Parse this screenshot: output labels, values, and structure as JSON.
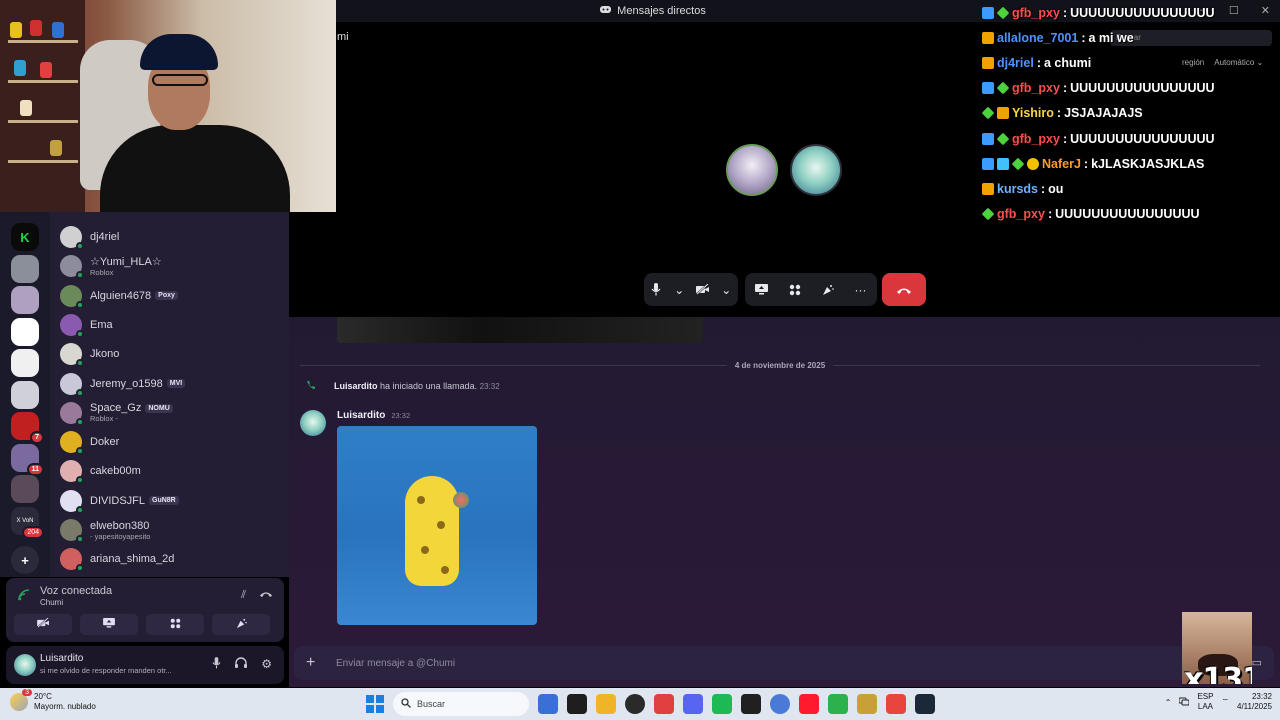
{
  "window": {
    "title": "Mensajes directos",
    "controls": [
      "—",
      "☐",
      "✕"
    ]
  },
  "call": {
    "caption": "mi",
    "search_placeholder": "Buscar",
    "region_label": "región",
    "region_value": "Automático ⌄"
  },
  "twitch_chat": [
    {
      "user": "gfb_pxy",
      "color": "#ff4d4d",
      "badges": [
        "b-prime",
        "b-gem"
      ],
      "message": "UUUUUUUUUUUUUUUU"
    },
    {
      "user": "allalone_7001",
      "color": "#4f93ff",
      "badges": [
        "b-sub"
      ],
      "message": "a mi we"
    },
    {
      "user": "dj4riel",
      "color": "#4f93ff",
      "badges": [
        "b-sub"
      ],
      "message": "a chumi"
    },
    {
      "user": "gfb_pxy",
      "color": "#ff4d4d",
      "badges": [
        "b-prime",
        "b-gem"
      ],
      "message": "UUUUUUUUUUUUUUUU"
    },
    {
      "user": "Yishiro",
      "color": "#ffd24a",
      "badges": [
        "b-gem",
        "b-sub"
      ],
      "message": "JSJAJAJAJS"
    },
    {
      "user": "gfb_pxy",
      "color": "#ff4d4d",
      "badges": [
        "b-prime",
        "b-gem"
      ],
      "message": "UUUUUUUUUUUUUUUU"
    },
    {
      "user": "NaferJ",
      "color": "#ff9a2e",
      "badges": [
        "b-prime",
        "b-blue",
        "b-gem",
        "b-coin"
      ],
      "message": "kJLASKJASJKLAS"
    },
    {
      "user": "kursds",
      "color": "#6fb2ff",
      "badges": [
        "b-sub"
      ],
      "message": "ou"
    },
    {
      "user": "gfb_pxy",
      "color": "#ff4d4d",
      "badges": [
        "b-gem"
      ],
      "message": "UUUUUUUUUUUUUUUU"
    }
  ],
  "members": [
    {
      "name": "dj4riel",
      "sub": "",
      "tag": "",
      "color": "#d0d0d0"
    },
    {
      "name": "☆Yumi_HLA☆",
      "sub": "Roblox",
      "tag": "",
      "color": "#8c8c9c"
    },
    {
      "name": "Alguien4678",
      "sub": "",
      "tag": "Poxy",
      "color": "#6a8a5a"
    },
    {
      "name": "Ema",
      "sub": "",
      "tag": "",
      "color": "#8a5ab0"
    },
    {
      "name": "Jkono",
      "sub": "",
      "tag": "",
      "color": "#d8d8d0"
    },
    {
      "name": "Jeremy_o1598",
      "sub": "",
      "tag": "MVI",
      "color": "#c8c8d8"
    },
    {
      "name": "Space_Gz",
      "sub": "Roblox -",
      "tag": "NOMU",
      "color": "#9a7a9a"
    },
    {
      "name": "Doker",
      "sub": "",
      "tag": "",
      "color": "#e0b020"
    },
    {
      "name": "cakeb00m",
      "sub": "",
      "tag": "",
      "color": "#e0b0b0"
    },
    {
      "name": "DIVIDSJFL",
      "sub": "",
      "tag": "GuN8R",
      "color": "#e0e0f0"
    },
    {
      "name": "elwebon380",
      "sub": "- yapesitoyapesito",
      "tag": "",
      "color": "#7a7a6a"
    },
    {
      "name": "ariana_shima_2d",
      "sub": "",
      "tag": "",
      "color": "#d06060"
    }
  ],
  "servers": [
    {
      "label": "K",
      "color": "#0a0a0a",
      "badge": ""
    },
    {
      "label": "",
      "color": "#8a8f9a",
      "badge": ""
    },
    {
      "label": "",
      "color": "#b0a0c0",
      "badge": ""
    },
    {
      "label": "",
      "color": "#ffffff",
      "badge": ""
    },
    {
      "label": "",
      "color": "#f0f0f0",
      "badge": ""
    },
    {
      "label": "",
      "color": "#d0d0d8",
      "badge": ""
    },
    {
      "label": "",
      "color": "#c02020",
      "badge": "7"
    },
    {
      "label": "",
      "color": "#7a6aa0",
      "badge": "11"
    },
    {
      "label": "",
      "color": "#5a4a5a",
      "badge": ""
    },
    {
      "label": "X VoN",
      "color": "#2a2a3a",
      "badge": "204"
    }
  ],
  "voice": {
    "title": "Voz conectada",
    "channel": "Chumi"
  },
  "user": {
    "name": "Luisardito",
    "status": "si me olvido de responder manden otr..."
  },
  "chat": {
    "date_divider": "4 de noviembre de 2025",
    "call_author": "Luisardito",
    "call_text": "ha iniciado una llamada.",
    "call_time": "23:32",
    "msg_author": "Luisardito",
    "msg_time": "23:32",
    "composer_placeholder": "Enviar mensaje a @Chumi"
  },
  "reaction_overlay": {
    "label": "x131"
  },
  "taskbar": {
    "weather_temp": "20°C",
    "weather_desc": "Mayorm. nublado",
    "weather_badge": "3",
    "search_label": "Buscar",
    "lang_top": "ESP",
    "lang_bottom": "LAA",
    "time": "23:32",
    "date": "4/11/2025",
    "apps": [
      "#3a6fd8",
      "#1e1e1e",
      "#f0b429",
      "#2a2a2a",
      "#e04040",
      "#5865f2",
      "#1db954",
      "#202020",
      "#4a7ad8",
      "#ff1b2d",
      "#2bb24c",
      "#c8a038",
      "#e8453c",
      "#1b2838"
    ]
  },
  "colors": {
    "accent": "#5865f2",
    "hangup": "#da373c",
    "online": "#23a559"
  }
}
